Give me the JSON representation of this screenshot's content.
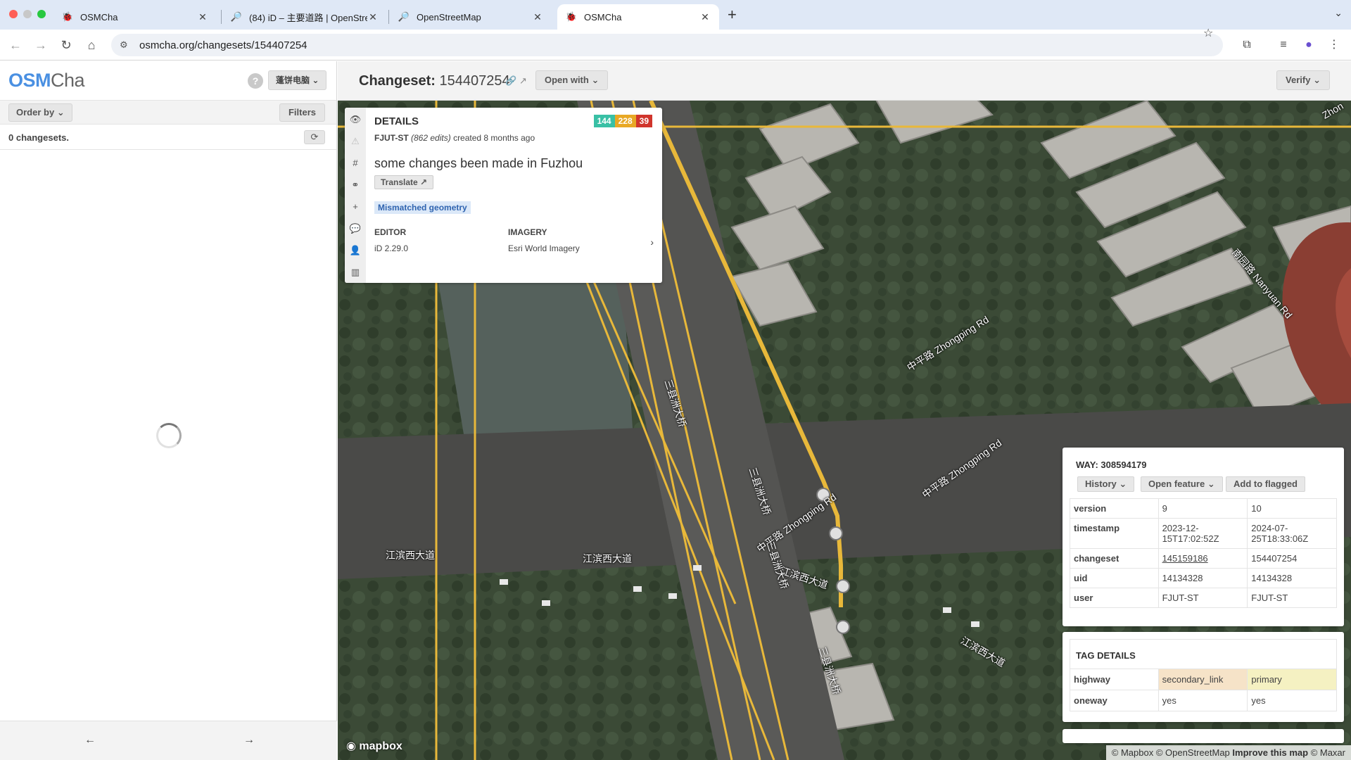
{
  "browser": {
    "tabs": [
      {
        "label": "OSMCha",
        "icon": "osmcha-icon",
        "active": false
      },
      {
        "label": "(84) iD – 主要道路 | OpenStre",
        "icon": "openstreetmap-icon",
        "active": false
      },
      {
        "label": "OpenStreetMap",
        "icon": "openstreetmap-icon",
        "active": false
      },
      {
        "label": "OSMCha",
        "icon": "osmcha-icon",
        "active": true
      }
    ],
    "url": "osmcha.org/changesets/154407254"
  },
  "sidebar": {
    "logo_osm": "OSM",
    "logo_cha": "Cha",
    "help": "?",
    "user": "蓬饼电脑",
    "order_by": "Order by",
    "filters": "Filters",
    "count": "0 changesets.",
    "prev": "←",
    "next": "→"
  },
  "header": {
    "changeset_label": "Changeset:",
    "changeset_id": "154407254",
    "open_with": "Open with",
    "verify": "Verify"
  },
  "details": {
    "title": "DETAILS",
    "badges": [
      {
        "value": "144",
        "color": "#39c0a5"
      },
      {
        "value": "228",
        "color": "#e8a825"
      },
      {
        "value": "39",
        "color": "#d0352c"
      }
    ],
    "user": "FJUT-ST",
    "edits": "(862 edits)",
    "created": "created 8 months ago",
    "comment": "some changes been made in Fuzhou",
    "translate": "Translate",
    "flag": "Mismatched geometry",
    "editor_label": "EDITOR",
    "editor": "iD 2.29.0",
    "imagery_label": "IMAGERY",
    "imagery": "Esri World Imagery"
  },
  "way": {
    "title": "WAY: 308594179",
    "history": "History",
    "open_feature": "Open feature",
    "add_flagged": "Add to flagged",
    "rows": [
      {
        "key": "version",
        "old": "9",
        "new": "10"
      },
      {
        "key": "timestamp",
        "old": "2023-12-15T17:02:52Z",
        "new": "2024-07-25T18:33:06Z"
      },
      {
        "key": "changeset",
        "old": "145159186",
        "new": "154407254"
      },
      {
        "key": "uid",
        "old": "14134328",
        "new": "14134328"
      },
      {
        "key": "user",
        "old": "FJUT-ST",
        "new": "FJUT-ST"
      }
    ]
  },
  "tags": {
    "title": "TAG DETAILS",
    "rows": [
      {
        "key": "highway",
        "old": "secondary_link",
        "new": "primary"
      },
      {
        "key": "oneway",
        "old": "yes",
        "new": "yes"
      }
    ]
  },
  "map": {
    "labels": {
      "jiangbin_1": "江滨西大道",
      "jiangbin_2": "江滨西大道",
      "jiangbin_3": "江滨西大道",
      "jiangbin_4": "江滨西大道",
      "zhongping_1": "中平路 Zhongping Rd",
      "zhongping_2": "中平路 Zhongping Rd",
      "zhongping_3": "中平路 Zhongping Rd",
      "nanyuan": "南园路 Nanyuan Rd",
      "sanxian_1": "三县洲大桥",
      "sanxian_2": "三县洲大桥",
      "sanxian_3": "三县洲大桥",
      "sanxian_4": "三县洲大桥",
      "corner": "Zhon"
    },
    "mapbox": "mapbox",
    "attribution_1": "© Mapbox © OpenStreetMap",
    "attribution_2": "Improve this map",
    "attribution_3": "© Maxar"
  },
  "colors": {
    "accent": "#4a90e2",
    "osm_line": "#e8b83a",
    "old_tag": "#f6e3c8",
    "new_tag": "#f5f1c2"
  }
}
